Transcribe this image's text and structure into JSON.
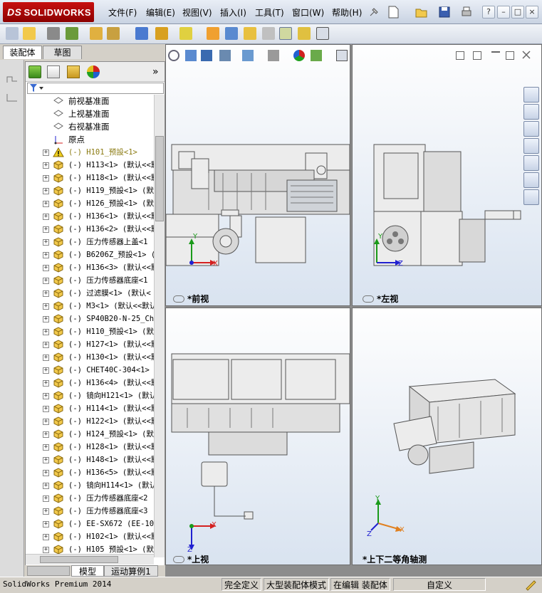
{
  "app": {
    "logo": "SOLIDWORKS",
    "logo_mark": "DS"
  },
  "menu": [
    "文件(F)",
    "编辑(E)",
    "视图(V)",
    "插入(I)",
    "工具(T)",
    "窗口(W)",
    "帮助(H)"
  ],
  "window_controls": {
    "help": "?",
    "minimize": "–",
    "restore": "□",
    "close": "×"
  },
  "panel_tabs": [
    "装配体",
    "草图"
  ],
  "tree_panel": {
    "collapse_label": "»"
  },
  "tree": [
    {
      "label": "前视基准面",
      "icon": "plane-icon",
      "expand": false,
      "cn": true
    },
    {
      "label": "上视基准面",
      "icon": "plane-icon",
      "expand": false,
      "cn": true
    },
    {
      "label": "右视基准面",
      "icon": "plane-icon",
      "expand": false,
      "cn": true
    },
    {
      "label": "原点",
      "icon": "origin-icon",
      "expand": false,
      "cn": true
    },
    {
      "label": "(-) H101_预設<1>",
      "icon": "warning-icon",
      "expand": true,
      "cn": false,
      "warn": true
    },
    {
      "label": "(-) H113<1> (默认<<默",
      "icon": "part-icon",
      "expand": true
    },
    {
      "label": "(-) H118<1> (默认<<默",
      "icon": "part-icon",
      "expand": true
    },
    {
      "label": "(-) H119_预設<1> (默",
      "icon": "part-icon",
      "expand": true
    },
    {
      "label": "(-) H126_预設<1> (默",
      "icon": "part-icon",
      "expand": true
    },
    {
      "label": "(-) H136<1> (默认<<默",
      "icon": "part-icon",
      "expand": true
    },
    {
      "label": "(-) H136<2> (默认<<默",
      "icon": "part-icon",
      "expand": true
    },
    {
      "label": "(-) 压力传感器上盖<1",
      "icon": "part-icon",
      "expand": true
    },
    {
      "label": "(-) B6206Z_预設<1> (",
      "icon": "part-icon",
      "expand": true
    },
    {
      "label": "(-) H136<3> (默认<<默",
      "icon": "part-icon",
      "expand": true
    },
    {
      "label": "(-) 压力传感器底座<1",
      "icon": "part-icon",
      "expand": true
    },
    {
      "label": "(-) 过滤膜<1> (默认<",
      "icon": "part-icon",
      "expand": true
    },
    {
      "label": "(-) M3<1> (默认<<默认",
      "icon": "part-icon",
      "expand": true
    },
    {
      "label": "(-) SP40B20-N-25_Cha",
      "icon": "part-icon",
      "expand": true
    },
    {
      "label": "(-) H110_预設<1> (默",
      "icon": "part-icon",
      "expand": true
    },
    {
      "label": "(-) H127<1> (默认<<默",
      "icon": "part-icon",
      "expand": true
    },
    {
      "label": "(-) H130<1> (默认<<默",
      "icon": "part-icon",
      "expand": true
    },
    {
      "label": "(-) CHET40C-304<1> (",
      "icon": "part-icon",
      "expand": true
    },
    {
      "label": "(-) H136<4> (默认<<默",
      "icon": "part-icon",
      "expand": true
    },
    {
      "label": "(-) 镜向H121<1> (默认",
      "icon": "part-icon",
      "expand": true
    },
    {
      "label": "(-) H114<1> (默认<<默",
      "icon": "part-icon",
      "expand": true
    },
    {
      "label": "(-) H122<1> (默认<<默",
      "icon": "part-icon",
      "expand": true
    },
    {
      "label": "(-) H124_预設<1> (默",
      "icon": "part-icon",
      "expand": true
    },
    {
      "label": "(-) H128<1> (默认<<默",
      "icon": "part-icon",
      "expand": true
    },
    {
      "label": "(-) H148<1> (默认<<默",
      "icon": "part-icon",
      "expand": true
    },
    {
      "label": "(-) H136<5> (默认<<默",
      "icon": "part-icon",
      "expand": true
    },
    {
      "label": "(-) 镜向H114<1> (默认",
      "icon": "part-icon",
      "expand": true
    },
    {
      "label": "(-) 压力传感器底座<2",
      "icon": "part-icon",
      "expand": true
    },
    {
      "label": "(-) 压力传感器底座<3",
      "icon": "part-icon",
      "expand": true
    },
    {
      "label": "(-) EE-SX672 (EE-1006",
      "icon": "part-icon",
      "expand": true
    },
    {
      "label": "(-) H102<1> (默认<<默",
      "icon": "part-icon",
      "expand": true
    },
    {
      "label": "(-) H105 预設<1> (默",
      "icon": "part-icon",
      "expand": true
    }
  ],
  "bottom_tabs": [
    "模型",
    "运动算例1"
  ],
  "viewports": {
    "front": "*前视",
    "left": "*左视",
    "top": "*上视",
    "iso": "*上下二等角轴测"
  },
  "axes": {
    "x": "X",
    "y": "Y",
    "z": "Z"
  },
  "status": {
    "product": "SolidWorks Premium 2014",
    "s1": "完全定义",
    "s2": "大型装配体模式",
    "s3": "在编辑 装配体",
    "s4": "自定义"
  },
  "colors": {
    "accent": "#c81010",
    "triad_x": "#d42020",
    "triad_y": "#1a9a1a",
    "triad_z": "#2020d0",
    "iso_x": "#e08020"
  }
}
